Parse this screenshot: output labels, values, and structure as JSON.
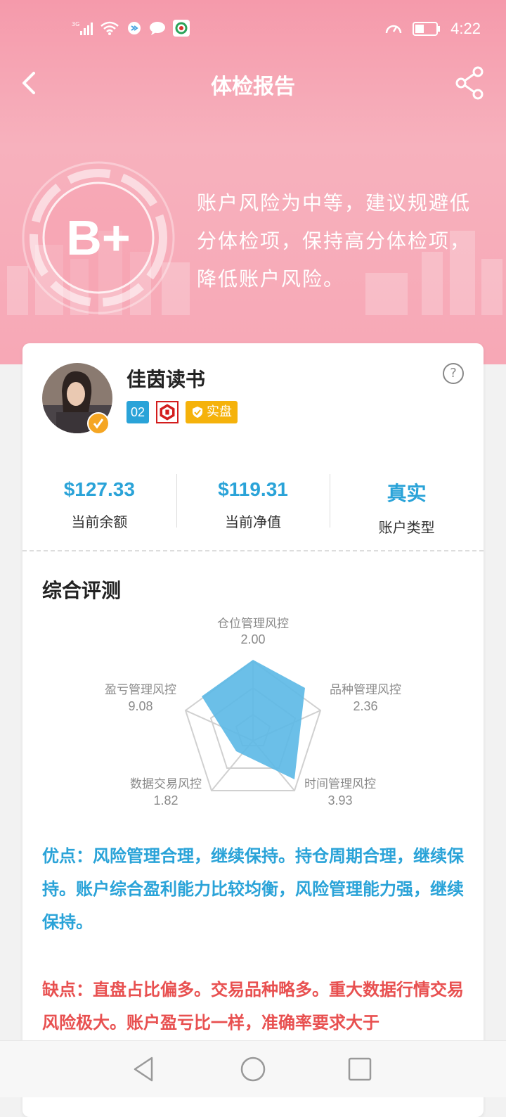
{
  "status": {
    "network": "3G",
    "time": "4:22"
  },
  "header": {
    "title": "体检报告"
  },
  "hero": {
    "grade": "B+",
    "message": "账户风险为中等，建议规避低分体检项，保持高分体检项，降低账户风险。"
  },
  "profile": {
    "name": "佳茵读书",
    "level": "02",
    "real_tag": "实盘",
    "help": "?"
  },
  "stats": [
    {
      "value": "$127.33",
      "label": "当前余额"
    },
    {
      "value": "$119.31",
      "label": "当前净值"
    },
    {
      "value": "真实",
      "label": "账户类型"
    }
  ],
  "evaluation": {
    "title": "综合评测",
    "axes": [
      {
        "label": "仓位管理风控",
        "value": "2.00"
      },
      {
        "label": "品种管理风控",
        "value": "2.36"
      },
      {
        "label": "时间管理风控",
        "value": "3.93"
      },
      {
        "label": "数据交易风控",
        "value": "1.82"
      },
      {
        "label": "盈亏管理风控",
        "value": "9.08"
      }
    ],
    "pros": "优点：风险管理合理，继续保持。持仓周期合理，继续保持。账户综合盈利能力比较均衡，风险管理能力强，继续保持。",
    "cons": "缺点：直盘占比偏多。交易品种略多。重大数据行情交易风险极大。账户盈亏比一样，准确率要求大于"
  },
  "colors": {
    "accent": "#2aa3d8",
    "danger": "#e85050",
    "hero": "#f7a8b6",
    "radar_fill": "#5bb8e6"
  }
}
